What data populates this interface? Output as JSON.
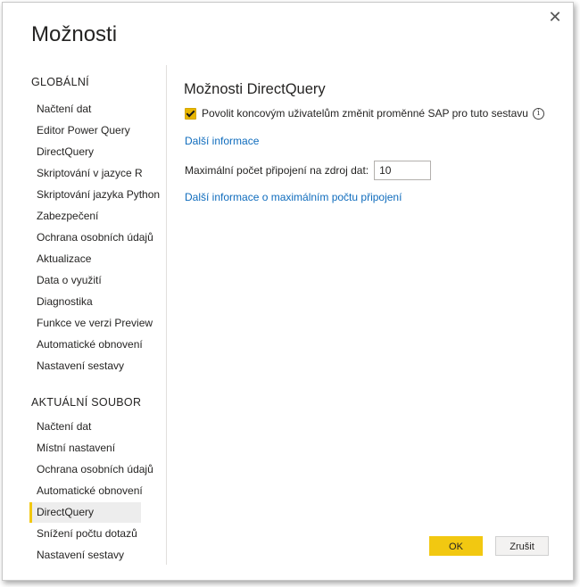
{
  "dialog": {
    "title": "Možnosti",
    "close_icon": "close-icon",
    "close_glyph": "✕"
  },
  "sidebar": {
    "global_header": "GLOBÁLNÍ",
    "global_items": [
      {
        "label": "Načtení dat"
      },
      {
        "label": "Editor Power Query"
      },
      {
        "label": "DirectQuery"
      },
      {
        "label": "Skriptování v jazyce R"
      },
      {
        "label": "Skriptování jazyka Python"
      },
      {
        "label": "Zabezpečení"
      },
      {
        "label": "Ochrana osobních údajů"
      },
      {
        "label": "Aktualizace"
      },
      {
        "label": "Data o využití"
      },
      {
        "label": "Diagnostika"
      },
      {
        "label": "Funkce ve verzi Preview"
      },
      {
        "label": "Automatické obnovení"
      },
      {
        "label": "Nastavení sestavy"
      }
    ],
    "file_header": "AKTUÁLNÍ SOUBOR",
    "file_items": [
      {
        "label": "Načtení dat"
      },
      {
        "label": "Místní nastavení"
      },
      {
        "label": "Ochrana osobních údajů"
      },
      {
        "label": "Automatické obnovení"
      },
      {
        "label": "DirectQuery",
        "selected": true
      },
      {
        "label": "Snížení počtu dotazů"
      },
      {
        "label": "Nastavení sestavy"
      }
    ]
  },
  "content": {
    "title": "Možnosti DirectQuery",
    "checkbox_label": "Povolit koncovým uživatelům změnit proměnné SAP pro tuto sestavu",
    "checkbox_checked": true,
    "info_glyph": "i",
    "more_info_link": "Další informace",
    "max_connections_label": "Maximální počet připojení na zdroj dat:",
    "max_connections_value": "10",
    "max_connections_link": "Další informace o maximálním počtu připojení"
  },
  "buttons": {
    "ok": "OK",
    "cancel": "Zrušit"
  },
  "colors": {
    "accent": "#f2c811",
    "link": "#0f6cbd",
    "selected_bg": "#ededed"
  }
}
